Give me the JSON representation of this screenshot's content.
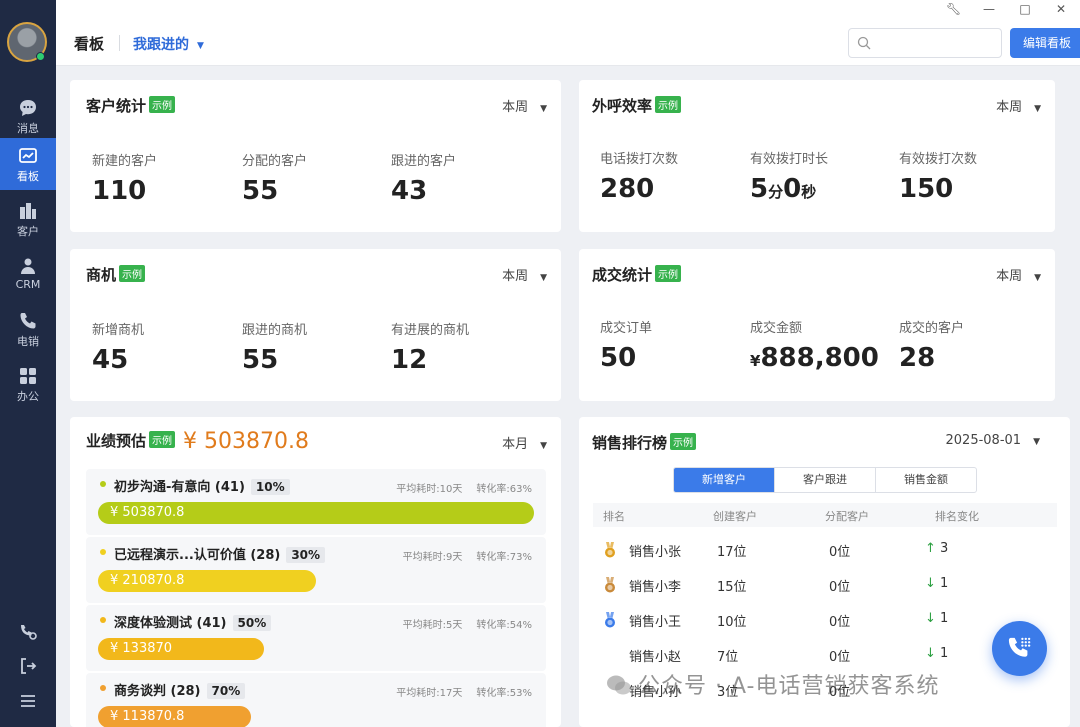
{
  "nav": {
    "items": [
      {
        "label": "消息",
        "icon": "chat-bubble-icon"
      },
      {
        "label": "看板",
        "icon": "chart-icon"
      },
      {
        "label": "客户",
        "icon": "building-icon"
      },
      {
        "label": "CRM",
        "icon": "user-icon"
      },
      {
        "label": "电销",
        "icon": "phone-icon"
      },
      {
        "label": "办公",
        "icon": "grid-icon"
      }
    ],
    "active": "看板"
  },
  "header": {
    "title": "看板",
    "view": "我跟进的",
    "search_placeholder": "",
    "edit_button": "编辑看板"
  },
  "cards": {
    "customers": {
      "title": "客户统计",
      "tag": "示例",
      "period": "本周",
      "stats": [
        {
          "label": "新建的客户",
          "value": "110"
        },
        {
          "label": "分配的客户",
          "value": "55"
        },
        {
          "label": "跟进的客户",
          "value": "43"
        }
      ]
    },
    "calls": {
      "title": "外呼效率",
      "tag": "示例",
      "period": "本周",
      "stats": [
        {
          "label": "电话拨打次数",
          "value": "280"
        },
        {
          "label": "有效拨打时长",
          "value_min": "5",
          "unit_min": "分",
          "value_sec": "0",
          "unit_sec": "秒"
        },
        {
          "label": "有效拨打次数",
          "value": "150"
        }
      ]
    },
    "opportunities": {
      "title": "商机",
      "tag": "示例",
      "period": "本周",
      "stats": [
        {
          "label": "新增商机",
          "value": "45"
        },
        {
          "label": "跟进的商机",
          "value": "55"
        },
        {
          "label": "有进展的商机",
          "value": "12"
        }
      ]
    },
    "deals": {
      "title": "成交统计",
      "tag": "示例",
      "period": "本周",
      "stats": [
        {
          "label": "成交订单",
          "value": "50"
        },
        {
          "label": "成交金额",
          "currency": "¥",
          "value": "888,800"
        },
        {
          "label": "成交的客户",
          "value": "28"
        }
      ]
    },
    "forecast": {
      "title": "业绩预估",
      "tag": "示例",
      "total": "¥ 503870.8",
      "period": "本月",
      "stages": [
        {
          "name": "初步沟通-有意向 (41)",
          "pct": "10%",
          "avg": "平均耗时:10天",
          "conv": "转化率:63%",
          "amount": "¥ 503870.8",
          "fill": 1.0,
          "color": "#b5cc18"
        },
        {
          "name": "已远程演示...认可价值 (28)",
          "pct": "30%",
          "avg": "平均耗时:9天",
          "conv": "转化率:73%",
          "amount": "¥ 210870.8",
          "fill": 0.5,
          "color": "#f0d020"
        },
        {
          "name": "深度体验测试 (41)",
          "pct": "50%",
          "avg": "平均耗时:5天",
          "conv": "转化率:54%",
          "amount": "¥ 133870",
          "fill": 0.38,
          "color": "#f2b81b"
        },
        {
          "name": "商务谈判 (28)",
          "pct": "70%",
          "avg": "平均耗时:17天",
          "conv": "转化率:53%",
          "amount": "¥ 113870.8",
          "fill": 0.35,
          "color": "#f0a030"
        }
      ]
    },
    "ranking": {
      "title": "销售排行榜",
      "tag": "示例",
      "date": "2025-08-01",
      "tabs": [
        "新增客户",
        "客户跟进",
        "销售金额"
      ],
      "active_tab": "新增客户",
      "columns": [
        "排名",
        "创建客户",
        "分配客户",
        "排名变化"
      ],
      "rows": [
        {
          "name": "销售小张",
          "created": "17位",
          "assigned": "0位",
          "change_dir": "up",
          "change": "3",
          "medal": "#e0a020"
        },
        {
          "name": "销售小李",
          "created": "15位",
          "assigned": "0位",
          "change_dir": "down",
          "change": "1",
          "medal": "#c98a3a"
        },
        {
          "name": "销售小王",
          "created": "10位",
          "assigned": "0位",
          "change_dir": "down",
          "change": "1",
          "medal": "#3b7be9"
        },
        {
          "name": "销售小赵",
          "created": "7位",
          "assigned": "0位",
          "change_dir": "down",
          "change": "1",
          "medal": ""
        },
        {
          "name": "销售小孙",
          "created": "3位",
          "assigned": "0位",
          "change_dir": "",
          "change": "",
          "medal": ""
        }
      ]
    }
  },
  "watermark": "公众号 · A-电话营销获客系统",
  "colors": {
    "sidebar": "#1f2a44",
    "accent": "#3b7be9",
    "tag": "#37b24d",
    "forecast_total": "#e07b1c"
  }
}
